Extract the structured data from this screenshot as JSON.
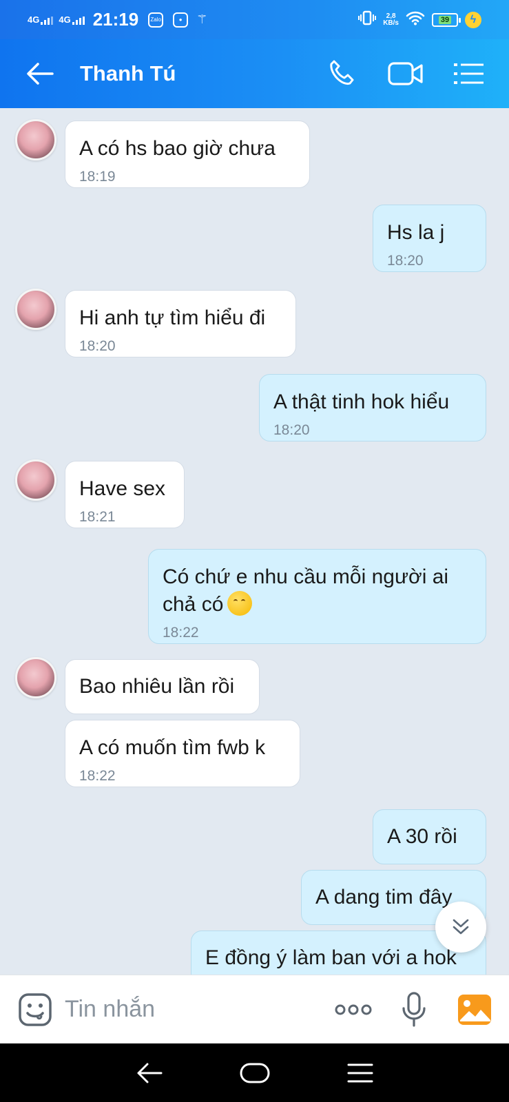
{
  "status_bar": {
    "network_1": "4G",
    "network_2": "4G",
    "time": "21:19",
    "app_icon_label": "Zalo",
    "speed_value": "2,8",
    "speed_unit": "KB/s",
    "battery": "39"
  },
  "header": {
    "contact_name": "Thanh Tú"
  },
  "messages": [
    {
      "dir": "in",
      "text": "A có hs bao giờ chưa",
      "time": "18:19"
    },
    {
      "dir": "out",
      "text": "Hs la j",
      "time": "18:20"
    },
    {
      "dir": "in",
      "text": "Hi anh tự tìm hiểu đi",
      "time": "18:20"
    },
    {
      "dir": "out",
      "text": "A thật tinh hok hiểu",
      "time": "18:20"
    },
    {
      "dir": "in",
      "text": "Have sex",
      "time": "18:21"
    },
    {
      "dir": "out",
      "text_line1": "Có chứ e nhu cầu mỗi người ai",
      "text_line2": "chả có",
      "emoji": "hand-over-mouth-emoji",
      "time": "18:22"
    },
    {
      "dir": "in",
      "text": "Bao nhiêu lần rồi"
    },
    {
      "dir": "in",
      "text": "A có muốn tìm fwb k",
      "time": "18:22"
    },
    {
      "dir": "out",
      "text": "A 30 rồi"
    },
    {
      "dir": "out",
      "text": "A dang tim đây"
    },
    {
      "dir": "out",
      "text": "E đồng ý làm ban với a hok"
    }
  ],
  "input_bar": {
    "placeholder": "Tin nhắn",
    "icons": [
      "emoji-sticker-icon",
      "more-options-icon",
      "microphone-icon",
      "image-gallery-icon"
    ]
  },
  "icons": {
    "back": "back-arrow-icon",
    "call": "phone-icon",
    "video": "video-camera-icon",
    "menu": "menu-list-icon",
    "scroll": "double-chevron-down-icon"
  },
  "colors": {
    "header_start": "#0f74ef",
    "header_end": "#1fb1f9",
    "incoming_bubble": "#ffffff",
    "outgoing_bubble": "#d4f1fe",
    "background": "#e2e9f1",
    "accent": "#1b8ff5"
  }
}
